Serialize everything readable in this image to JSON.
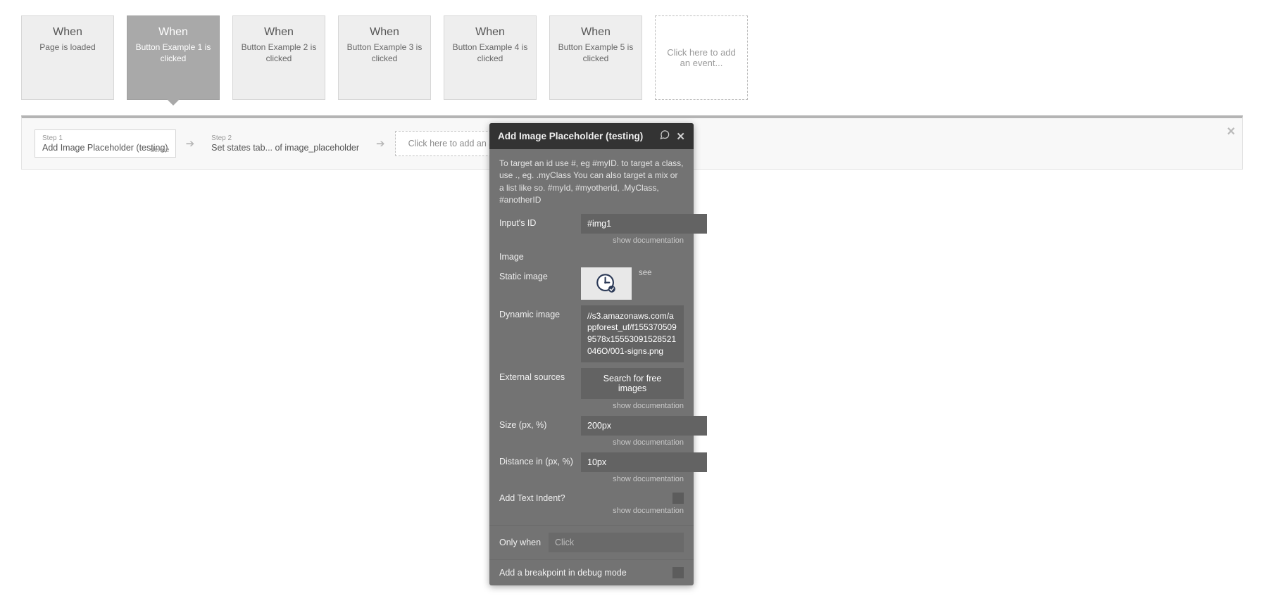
{
  "events": [
    {
      "when": "When",
      "desc": "Page is loaded"
    },
    {
      "when": "When",
      "desc": "Button Example 1 is clicked"
    },
    {
      "when": "When",
      "desc": "Button Example 2 is clicked"
    },
    {
      "when": "When",
      "desc": "Button Example 3 is clicked"
    },
    {
      "when": "When",
      "desc": "Button Example 4 is clicked"
    },
    {
      "when": "When",
      "desc": "Button Example 5 is clicked"
    }
  ],
  "add_event_text": "Click here to add an event...",
  "workflow": {
    "step1": {
      "label": "Step 1",
      "title": "Add Image Placeholder (testing)",
      "delete": "delete"
    },
    "step2": {
      "label": "Step 2",
      "title": "Set states tab... of image_placeholder"
    },
    "add_action": "Click here to add an action..."
  },
  "panel": {
    "title": "Add Image Placeholder (testing)",
    "help": "To target an id use #, eg #myID. to target a class, use ., eg. .myClass You can also target a mix or a list like so. #myId, #myotherid, .MyClass, #anotherID",
    "inputs_id": {
      "label": "Input's ID",
      "value": "#img1"
    },
    "show_doc": "show documentation",
    "image_section": "Image",
    "static_image_label": "Static image",
    "see": "see",
    "dynamic_image": {
      "label": "Dynamic image",
      "value": "//s3.amazonaws.com/appforest_uf/f1553705099578x15553091528521046O/001-signs.png"
    },
    "external_sources": {
      "label": "External sources",
      "button": "Search for free images"
    },
    "size": {
      "label": "Size (px, %)",
      "value": "200px"
    },
    "distance": {
      "label": "Distance in (px, %)",
      "value": "10px"
    },
    "text_indent_label": "Add Text Indent?",
    "only_when": {
      "label": "Only when",
      "placeholder": "Click"
    },
    "breakpoint_label": "Add a breakpoint in debug mode"
  }
}
